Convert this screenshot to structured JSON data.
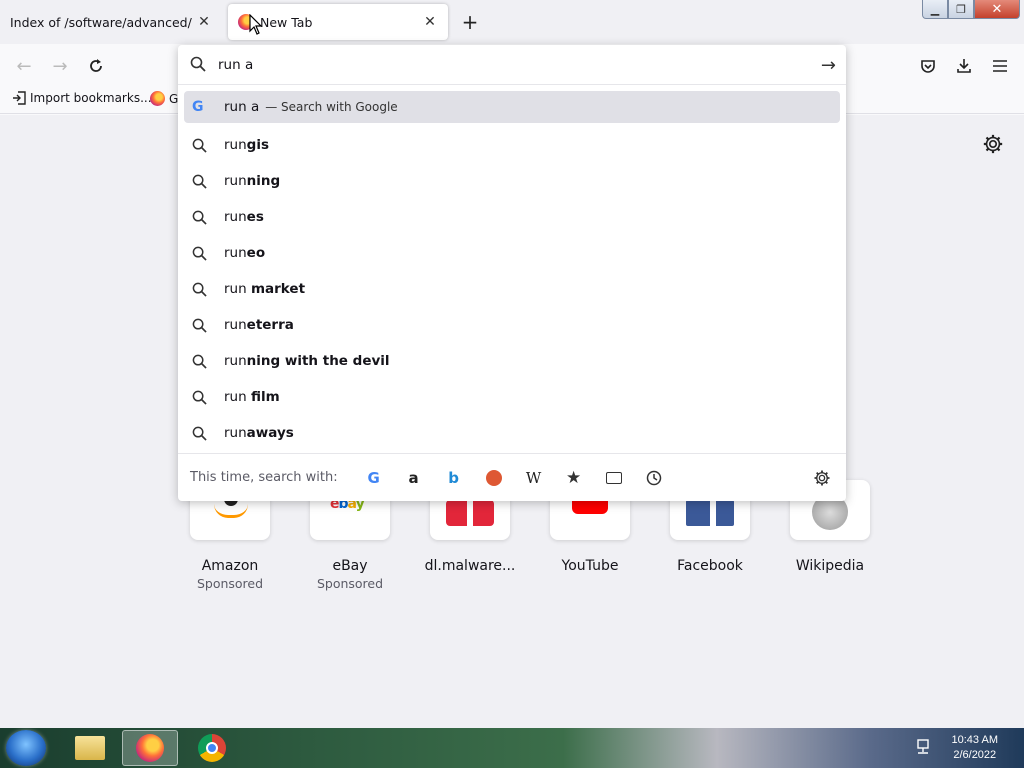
{
  "tabs": [
    {
      "title": "Index of /software/advanced/",
      "active": false
    },
    {
      "title": "New Tab",
      "active": true
    }
  ],
  "bookmarks": [
    {
      "label": "Import bookmarks..."
    },
    {
      "label": "G"
    }
  ],
  "urlbar": {
    "value": "run a",
    "results": [
      {
        "typed": "run a",
        "completion": "",
        "action": "— Search with Google",
        "icon": "google-icon",
        "selected": true
      },
      {
        "typed": "run",
        "completion": "gis",
        "icon": "search-icon"
      },
      {
        "typed": "run",
        "completion": "ning",
        "icon": "search-icon"
      },
      {
        "typed": "run",
        "completion": "es",
        "icon": "search-icon"
      },
      {
        "typed": "run",
        "completion": "eo",
        "icon": "search-icon"
      },
      {
        "typed": "run ",
        "completion": "market",
        "icon": "search-icon"
      },
      {
        "typed": "run",
        "completion": "eterra",
        "icon": "search-icon"
      },
      {
        "typed": "run",
        "completion": "ning with the devil",
        "icon": "search-icon"
      },
      {
        "typed": "run ",
        "completion": "film",
        "icon": "search-icon"
      },
      {
        "typed": "run",
        "completion": "aways",
        "icon": "search-icon"
      }
    ],
    "oneoff_label": "This time, search with:",
    "engines": [
      "google-icon",
      "amazon-icon",
      "bing-icon",
      "duckduckgo-icon",
      "wikipedia-icon",
      "bookmarks-star-icon",
      "tabs-icon",
      "history-clock-icon"
    ]
  },
  "tiles": [
    {
      "label": "Amazon",
      "sponsored": "Sponsored"
    },
    {
      "label": "eBay",
      "sponsored": "Sponsored"
    },
    {
      "label": "dl.malware...",
      "sponsored": ""
    },
    {
      "label": "YouTube",
      "sponsored": ""
    },
    {
      "label": "Facebook",
      "sponsored": ""
    },
    {
      "label": "Wikipedia",
      "sponsored": ""
    }
  ],
  "taskbar": {
    "time": "10:43 AM",
    "date": "2/6/2022"
  }
}
